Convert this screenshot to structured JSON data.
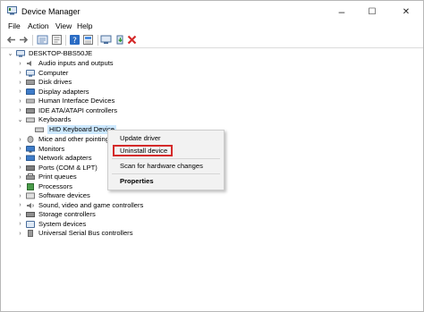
{
  "window": {
    "title": "Device Manager",
    "controls": {
      "minimize": "–",
      "maximize": "☐",
      "close": "✕"
    }
  },
  "menu": [
    "File",
    "Action",
    "View",
    "Help"
  ],
  "toolbar": {
    "icons": [
      "back-arrow-icon",
      "forward-arrow-icon",
      "device-tree-icon",
      "properties-icon",
      "help-icon",
      "details-icon",
      "scan-hardware-icon",
      "update-driver-icon",
      "uninstall-device-icon"
    ],
    "uninstall_color": "#d42a2a"
  },
  "tree": {
    "root": "DESKTOP-BBS50JE",
    "categories": [
      "Audio inputs and outputs",
      "Computer",
      "Disk drives",
      "Display adapters",
      "Human Interface Devices",
      "IDE ATA/ATAPI controllers",
      "Keyboards",
      "HID Keyboard Device",
      "Mice and other pointing",
      "Monitors",
      "Network adapters",
      "Ports (COM & LPT)",
      "Print queues",
      "Processors",
      "Software devices",
      "Sound, video and game controllers",
      "Storage controllers",
      "System devices",
      "Universal Serial Bus controllers"
    ],
    "selected_color": "#cce8ff"
  },
  "context_menu": {
    "items": [
      "Update driver",
      "Uninstall device",
      "Scan for hardware changes",
      "Properties"
    ],
    "highlight_color": "#d42a2a"
  }
}
